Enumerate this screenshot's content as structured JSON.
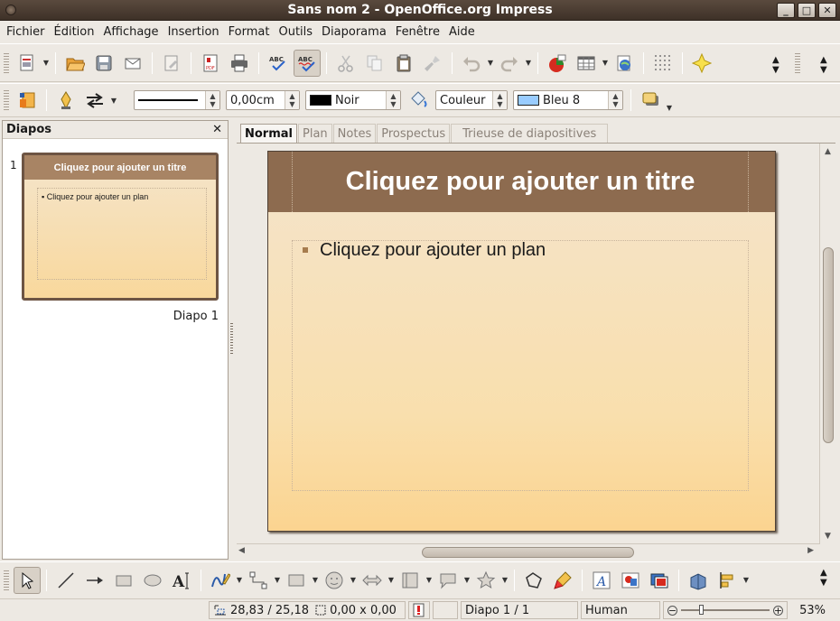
{
  "window": {
    "title": "Sans nom 2 - OpenOffice.org Impress",
    "buttons": [
      "_",
      "□",
      "✕"
    ]
  },
  "menu": [
    "Fichier",
    "Édition",
    "Affichage",
    "Insertion",
    "Format",
    "Outils",
    "Diaporama",
    "Fenêtre",
    "Aide"
  ],
  "line_toolbar": {
    "line_width": "0,00cm",
    "line_color": "Noir",
    "line_color_hex": "#000000",
    "area_style": "Couleur",
    "area_color": "Bleu 8",
    "area_color_hex": "#99ccff"
  },
  "slides_pane": {
    "title": "Diapos",
    "close": "✕",
    "slides": [
      {
        "number": "1",
        "label": "Diapo 1",
        "title": "Cliquez pour ajouter un titre",
        "outline": "Cliquez pour ajouter un plan"
      }
    ]
  },
  "view_tabs": [
    "Normal",
    "Plan",
    "Notes",
    "Prospectus",
    "Trieuse de diapositives"
  ],
  "slide": {
    "title": "Cliquez pour ajouter un titre",
    "outline": "Cliquez pour ajouter un plan",
    "colors": {
      "title_band": "#8d6b4f",
      "bullet": "#a67c4e"
    }
  },
  "status": {
    "position": "28,83 / 25,18",
    "size": "0,00 x 0,00",
    "slide": "Diapo 1 / 1",
    "theme": "Human",
    "zoom": "53%",
    "zoom_fraction": 0.53
  }
}
